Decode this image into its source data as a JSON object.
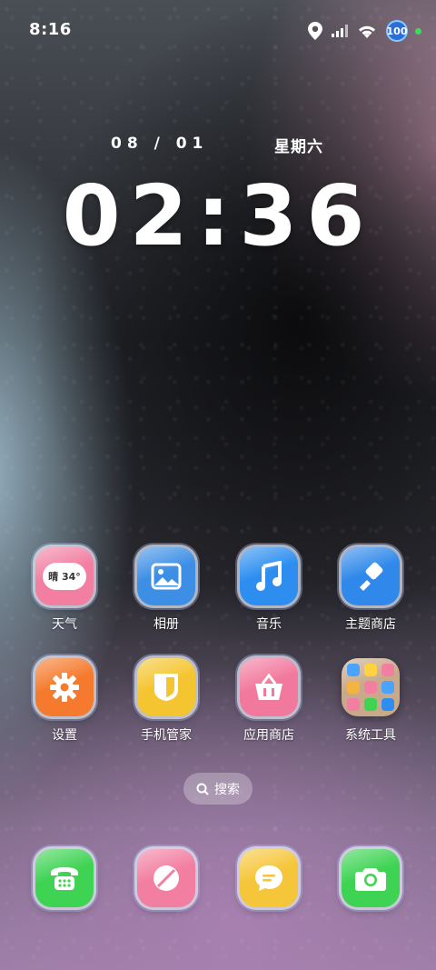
{
  "status_bar": {
    "time": "8:16",
    "battery": "100"
  },
  "lockscreen": {
    "date": "08 / 01",
    "weekday": "星期六",
    "clock": "02:36"
  },
  "home_rows": [
    [
      {
        "name": "weather",
        "label": "天气",
        "icon": "weather-icon",
        "badge": "晴 34°",
        "color": "#f27fa2"
      },
      {
        "name": "gallery",
        "label": "相册",
        "icon": "gallery-icon",
        "color": "#3d8fe6"
      },
      {
        "name": "music",
        "label": "音乐",
        "icon": "music-icon",
        "color": "#2d8ef0"
      },
      {
        "name": "theme-store",
        "label": "主题商店",
        "icon": "brush-icon",
        "color": "#2f88ea"
      }
    ],
    [
      {
        "name": "settings",
        "label": "设置",
        "icon": "gear-icon",
        "color": "#f57a2d"
      },
      {
        "name": "phone-manager",
        "label": "手机管家",
        "icon": "shield-icon",
        "color": "#f5c531"
      },
      {
        "name": "app-store",
        "label": "应用商店",
        "icon": "basket-icon",
        "color": "#f2799e"
      },
      {
        "name": "system-tools",
        "label": "系统工具",
        "icon": "folder-icon",
        "color": "#c8a98a"
      }
    ]
  ],
  "search": {
    "label": "搜索"
  },
  "dock": [
    {
      "name": "phone",
      "icon": "phone-icon",
      "color": "#3ed353"
    },
    {
      "name": "browser",
      "icon": "compass-icon",
      "color": "#f27fa2"
    },
    {
      "name": "messages",
      "icon": "message-icon",
      "color": "#f6c63a"
    },
    {
      "name": "camera",
      "icon": "camera-icon",
      "color": "#3ed353"
    }
  ]
}
